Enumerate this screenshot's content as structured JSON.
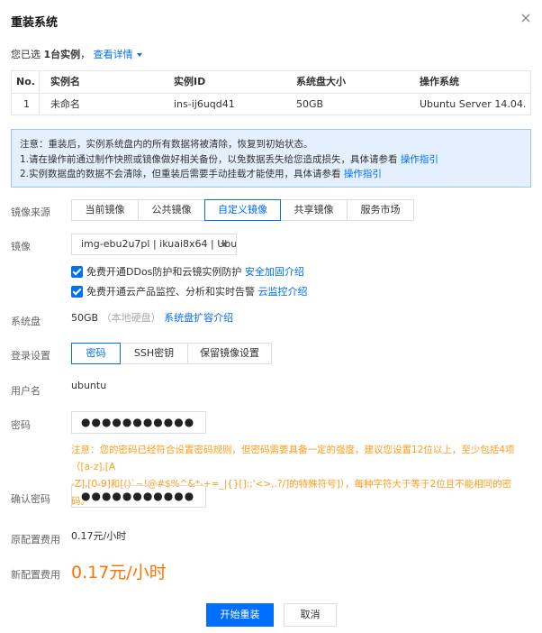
{
  "dialog": {
    "title": "重装系统",
    "close_icon": "close-icon"
  },
  "selection": {
    "prefix": "您已选",
    "count": "1台实例",
    "details_link": "查看详情"
  },
  "instance_table": {
    "columns": [
      "No.",
      "实例名",
      "实例ID",
      "系统盘大小",
      "操作系统"
    ],
    "rows": [
      [
        "1",
        "未命名",
        "ins-ij6uqd41",
        "50GB",
        "Ubuntu Server 14.04...."
      ]
    ]
  },
  "notice": {
    "line1": "注意：重装后，实例系统盘内的所有数据将被清除，恢复到初始状态。",
    "line2_text": "1.请在操作前通过制作快照或镜像做好相关备份，以免数据丢失给您造成损失，具体请参看",
    "line2_link": "操作指引",
    "line3_text": "2.实例数据盘的数据不会清除，但重装后需要手动挂载才能使用，具体请参看",
    "line3_link": "操作指引"
  },
  "image_source": {
    "label": "镜像来源",
    "options": [
      "当前镜像",
      "公共镜像",
      "自定义镜像",
      "共享镜像",
      "服务市场"
    ],
    "selected": "自定义镜像"
  },
  "image": {
    "label": "镜像",
    "selected_value": "img-ebu2u7pl | ikuai8x64 | Ubun",
    "ddos_text": "免费开通DDos防护和云镜实例防护",
    "ddos_link": "安全加固介绍",
    "monitor_text": "免费开通云产品监控、分析和实时告警",
    "monitor_link": "云监控介绍"
  },
  "system_disk": {
    "label": "系统盘",
    "size": "50GB",
    "type": "（本地硬盘）",
    "link": "系统盘扩容介绍"
  },
  "login": {
    "label": "登录设置",
    "options": [
      "密码",
      "SSH密钥",
      "保留镜像设置"
    ],
    "selected": "密码"
  },
  "username": {
    "label": "用户名",
    "value": "ubuntu"
  },
  "password": {
    "label": "密码",
    "value": "●●●●●●●●●●●",
    "warning_line1": "注意：您的密码已经符合设置密码规则，但密码需要具备一定的强度，建议您设置12位以上，至少包括4项（[a-z],[A",
    "warning_line2": "-Z],[0-9]和[()`~!@#$%^&*-+=_|{}[]:;'<>,.?/]的特殊符号]），每种字符大于等于2位且不能相同的密码。"
  },
  "confirm_password": {
    "label": "确认密码",
    "value": "●●●●●●●●●●●"
  },
  "original_cost": {
    "label": "原配置费用",
    "value": "0.17元/小时"
  },
  "new_cost": {
    "label": "新配置费用",
    "value": "0.17元/小时"
  },
  "actions": {
    "confirm": "开始重装",
    "cancel": "取消"
  },
  "colors": {
    "accent": "#006eff",
    "warning": "#ff9c19",
    "price": "#ff7200",
    "notice_bg": "#e5f0ff"
  }
}
